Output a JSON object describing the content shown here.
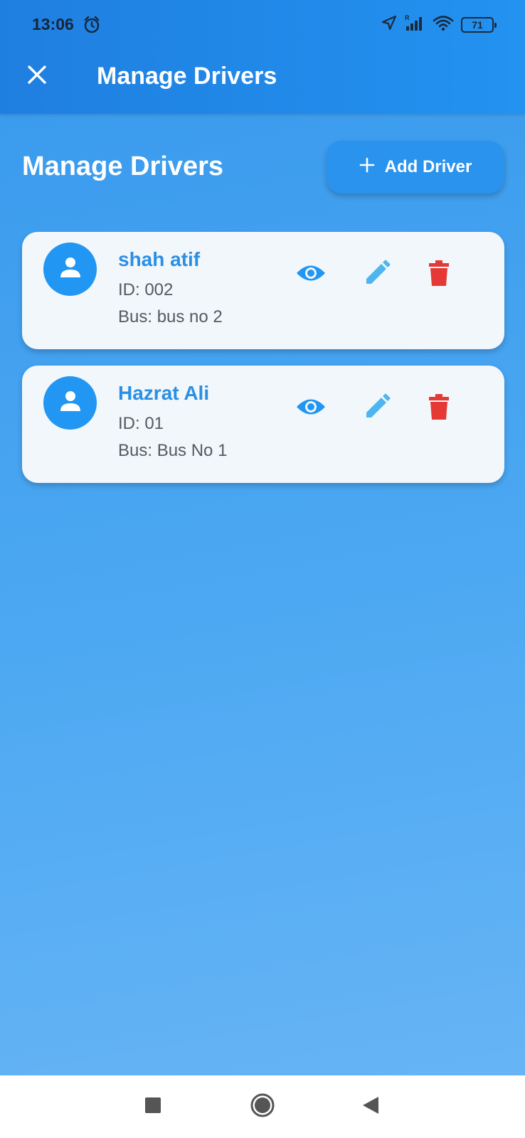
{
  "status_bar": {
    "time": "13:06",
    "battery": "71"
  },
  "app_bar": {
    "title": "Manage Drivers",
    "close_icon": "close-icon"
  },
  "page": {
    "heading": "Manage Drivers",
    "add_button_label": "Add Driver",
    "add_button_icon": "plus-icon"
  },
  "drivers": [
    {
      "name": "shah atif",
      "id": "ID: 002",
      "bus": "Bus: bus no 2"
    },
    {
      "name": "Hazrat Ali",
      "id": "ID: 01",
      "bus": "Bus: Bus No 1"
    }
  ],
  "actions": {
    "view_icon": "eye-icon",
    "edit_icon": "pencil-icon",
    "delete_icon": "trash-icon"
  },
  "colors": {
    "primary": "#2196f3",
    "name_text": "#2a8fe4",
    "edit": "#4db6f0",
    "delete": "#e53935",
    "card_bg": "#f2f7fb"
  },
  "nav_bar": {
    "icons": [
      "recent-apps-icon",
      "home-icon",
      "back-icon"
    ]
  }
}
